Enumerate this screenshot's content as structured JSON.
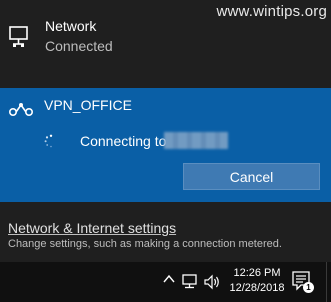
{
  "watermark": "www.wintips.org",
  "network": {
    "title": "Network",
    "status": "Connected",
    "icon": "ethernet-icon"
  },
  "vpn": {
    "name": "VPN_OFFICE",
    "status_text": "Connecting to",
    "cancel_label": "Cancel",
    "icon": "vpn-icon",
    "accent": "#0a5fa6"
  },
  "settings": {
    "link": "Network & Internet settings",
    "description": "Change settings, such as making a connection metered."
  },
  "taskbar": {
    "time": "12:26 PM",
    "date": "12/28/2018",
    "notification_count": "1"
  }
}
